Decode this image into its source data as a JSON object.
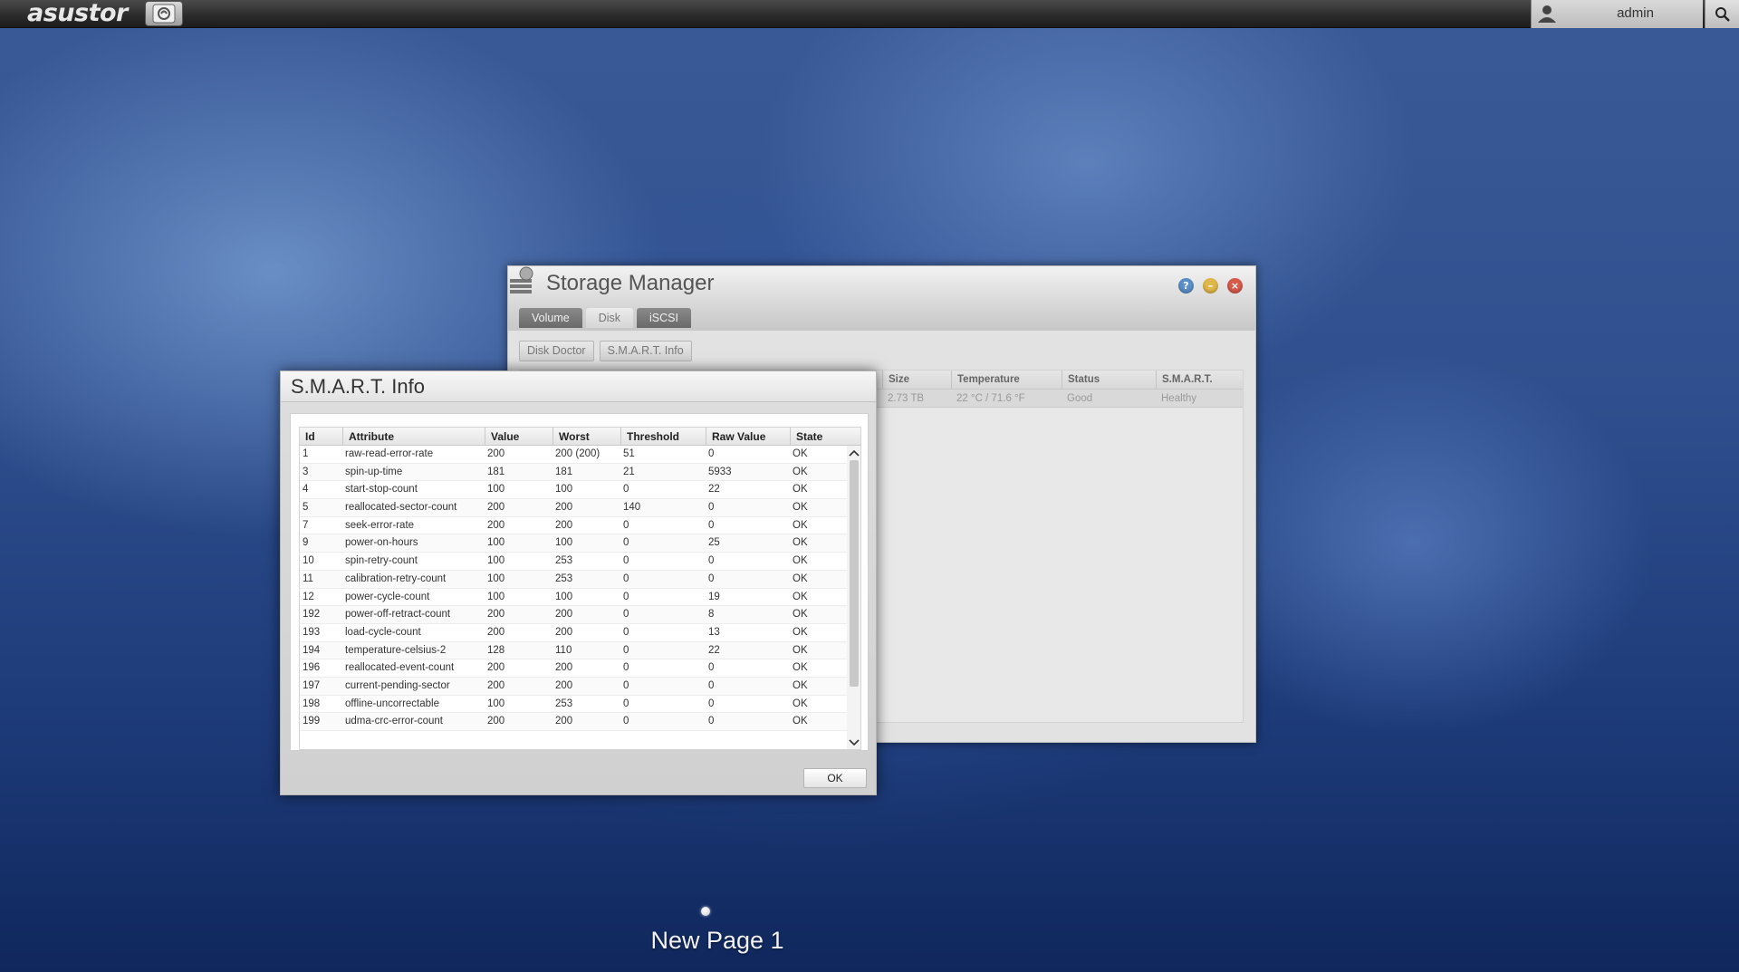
{
  "topbar": {
    "brand": "asustor",
    "username": "admin"
  },
  "icons": {
    "home": "home-logo-icon",
    "user": "user-icon",
    "search": "search-icon",
    "help": "help-icon",
    "minimize": "minimize-icon",
    "close": "close-icon"
  },
  "storage_manager": {
    "title": "Storage Manager",
    "tabs": [
      {
        "label": "Volume",
        "active": false
      },
      {
        "label": "Disk",
        "active": true
      },
      {
        "label": "iSCSI",
        "active": false
      }
    ],
    "toolbar": {
      "disk_doctor": "Disk Doctor",
      "smart_info": "S.M.A.R.T. Info"
    },
    "table": {
      "headers": [
        "Size",
        "Temperature",
        "Status",
        "S.M.A.R.T."
      ],
      "rows": [
        [
          "2.73 TB",
          "22 °C / 71.6 °F",
          "Good",
          "Healthy"
        ]
      ]
    }
  },
  "smart_dialog": {
    "title": "S.M.A.R.T. Info",
    "headers": [
      "Id",
      "Attribute",
      "Value",
      "Worst",
      "Threshold",
      "Raw Value",
      "State"
    ],
    "rows": [
      [
        "1",
        "raw-read-error-rate",
        "200",
        "200 (200)",
        "51",
        "0",
        "OK"
      ],
      [
        "3",
        "spin-up-time",
        "181",
        "181",
        "21",
        "5933",
        "OK"
      ],
      [
        "4",
        "start-stop-count",
        "100",
        "100",
        "0",
        "22",
        "OK"
      ],
      [
        "5",
        "reallocated-sector-count",
        "200",
        "200",
        "140",
        "0",
        "OK"
      ],
      [
        "7",
        "seek-error-rate",
        "200",
        "200",
        "0",
        "0",
        "OK"
      ],
      [
        "9",
        "power-on-hours",
        "100",
        "100",
        "0",
        "25",
        "OK"
      ],
      [
        "10",
        "spin-retry-count",
        "100",
        "253",
        "0",
        "0",
        "OK"
      ],
      [
        "11",
        "calibration-retry-count",
        "100",
        "253",
        "0",
        "0",
        "OK"
      ],
      [
        "12",
        "power-cycle-count",
        "100",
        "100",
        "0",
        "19",
        "OK"
      ],
      [
        "192",
        "power-off-retract-count",
        "200",
        "200",
        "0",
        "8",
        "OK"
      ],
      [
        "193",
        "load-cycle-count",
        "200",
        "200",
        "0",
        "13",
        "OK"
      ],
      [
        "194",
        "temperature-celsius-2",
        "128",
        "110",
        "0",
        "22",
        "OK"
      ],
      [
        "196",
        "reallocated-event-count",
        "200",
        "200",
        "0",
        "0",
        "OK"
      ],
      [
        "197",
        "current-pending-sector",
        "200",
        "200",
        "0",
        "0",
        "OK"
      ],
      [
        "198",
        "offline-uncorrectable",
        "100",
        "253",
        "0",
        "0",
        "OK"
      ],
      [
        "199",
        "udma-crc-error-count",
        "200",
        "200",
        "0",
        "0",
        "OK"
      ]
    ],
    "ok_label": "OK"
  },
  "desktop": {
    "page_label": "New Page 1"
  }
}
